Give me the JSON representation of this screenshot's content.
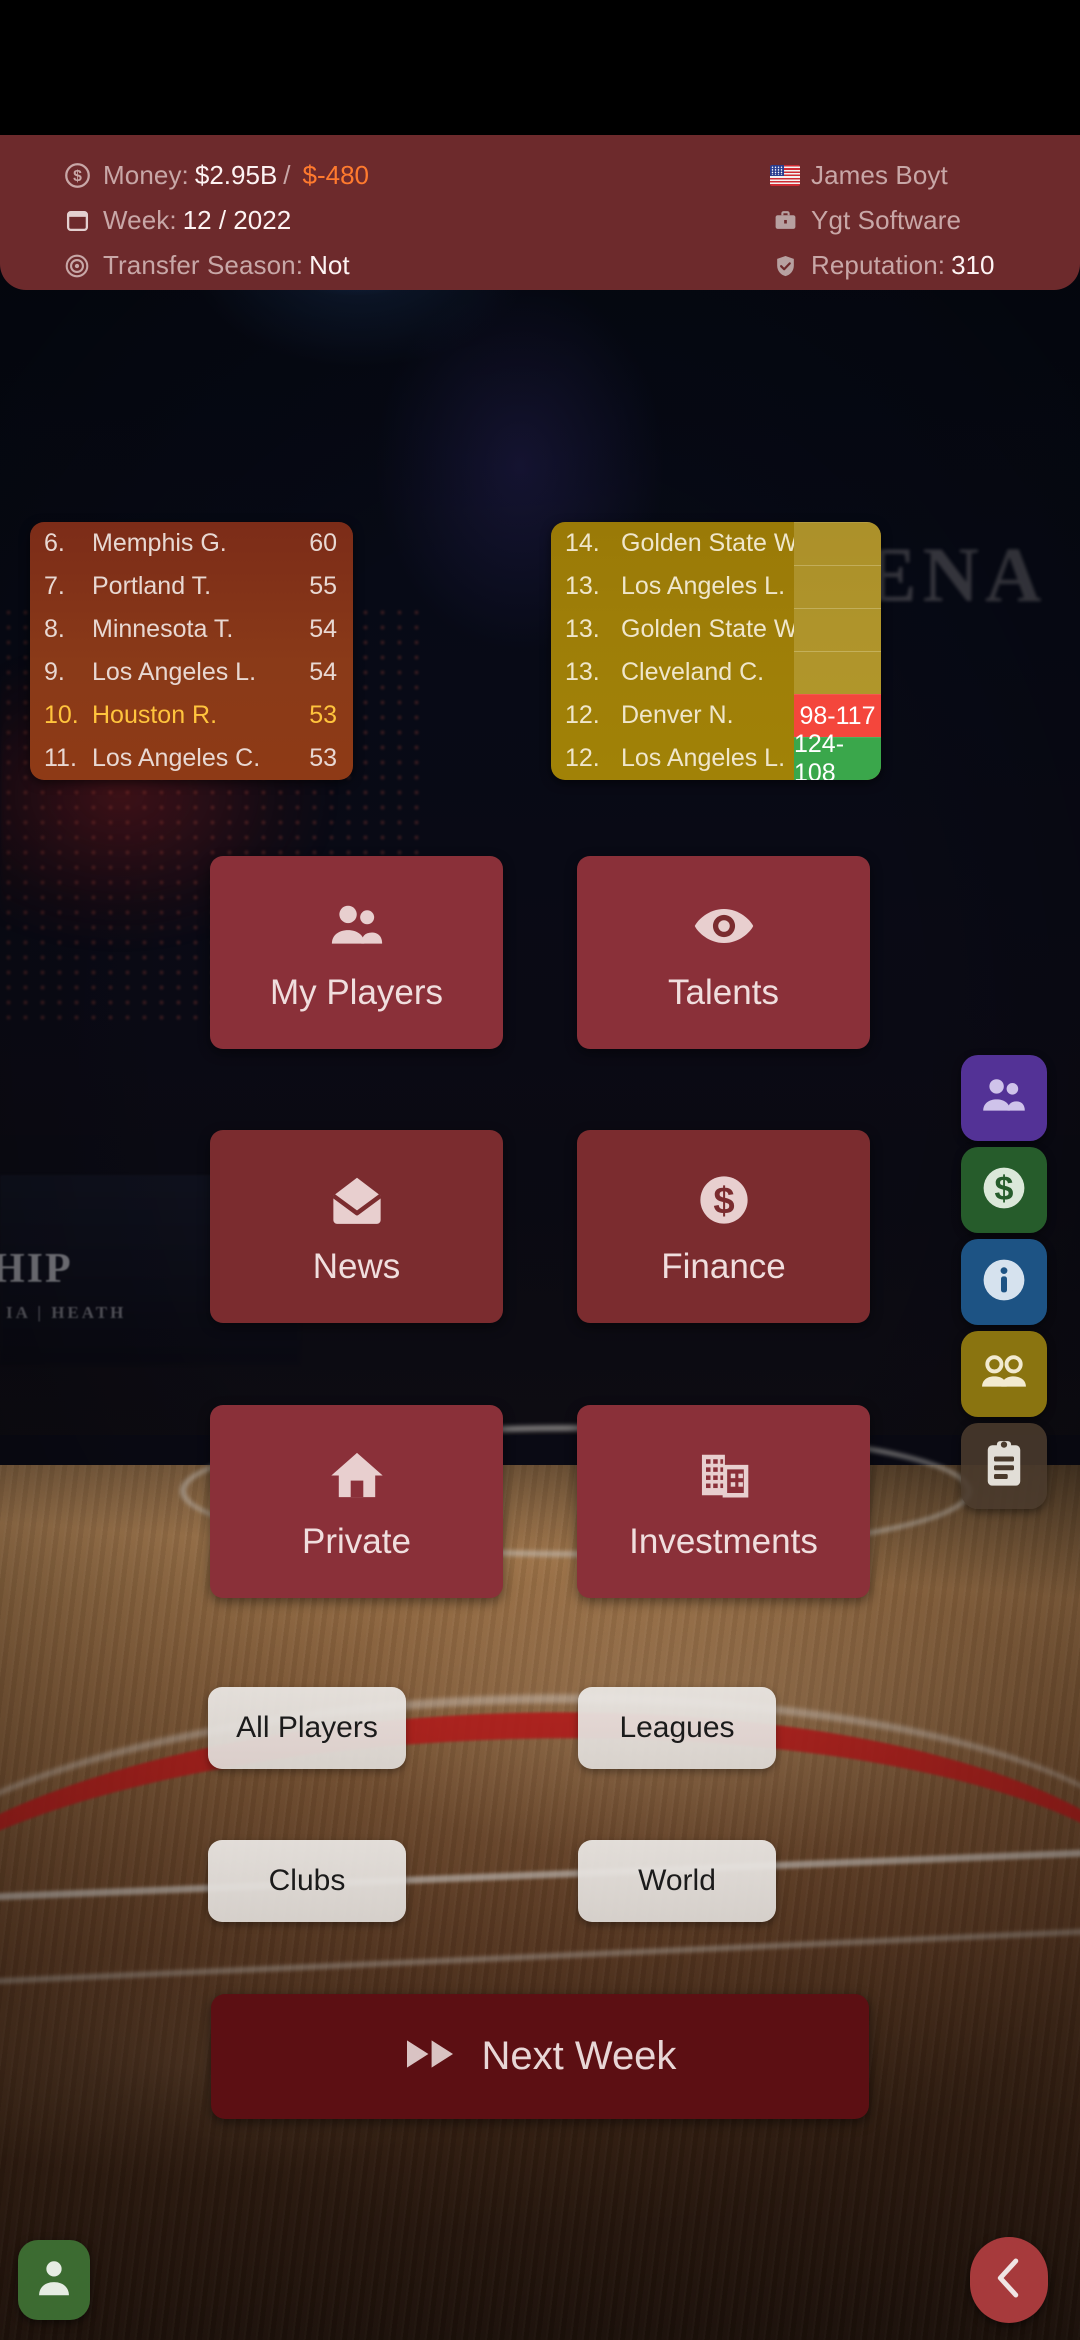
{
  "header": {
    "money": {
      "icon": "dollar-coin-icon",
      "label": "Money:",
      "value": "$2.95B",
      "separator": "/",
      "delta": "$-480"
    },
    "week": {
      "icon": "calendar-icon",
      "label": "Week:",
      "value": "12 / 2022"
    },
    "transfer": {
      "icon": "target-icon",
      "label": "Transfer Season:",
      "value": "Not"
    },
    "manager": {
      "icon": "us-flag-icon",
      "value": "James Boyt"
    },
    "company": {
      "icon": "briefcase-icon",
      "value": "Ygt Software"
    },
    "reputation": {
      "icon": "shield-check-icon",
      "label": "Reputation:",
      "value": "310"
    }
  },
  "standings": {
    "rows": [
      {
        "rank": "6.",
        "name": "Memphis G.",
        "value": "60",
        "highlight": false
      },
      {
        "rank": "7.",
        "name": "Portland T.",
        "value": "55",
        "highlight": false
      },
      {
        "rank": "8.",
        "name": "Minnesota T.",
        "value": "54",
        "highlight": false
      },
      {
        "rank": "9.",
        "name": "Los Angeles L.",
        "value": "54",
        "highlight": false
      },
      {
        "rank": "10.",
        "name": "Houston R.",
        "value": "53",
        "highlight": true
      },
      {
        "rank": "11.",
        "name": "Los Angeles C.",
        "value": "53",
        "highlight": false
      }
    ]
  },
  "fixtures": {
    "rows": [
      {
        "rank": "14.",
        "name": "Golden State W.",
        "score": "",
        "result": "none"
      },
      {
        "rank": "13.",
        "name": "Los Angeles L.",
        "score": "",
        "result": "none"
      },
      {
        "rank": "13.",
        "name": "Golden State W.",
        "score": "",
        "result": "none"
      },
      {
        "rank": "13.",
        "name": "Cleveland C.",
        "score": "",
        "result": "none"
      },
      {
        "rank": "12.",
        "name": "Denver N.",
        "score": "98-117",
        "result": "loss"
      },
      {
        "rank": "12.",
        "name": "Los Angeles L.",
        "score": "124-108",
        "result": "win"
      }
    ]
  },
  "tiles": [
    {
      "label": "My Players",
      "icon": "people-icon"
    },
    {
      "label": "Talents",
      "icon": "eye-icon"
    },
    {
      "label": "News",
      "icon": "mail-open-icon"
    },
    {
      "label": "Finance",
      "icon": "dollar-coin-icon"
    },
    {
      "label": "Private",
      "icon": "home-icon"
    },
    {
      "label": "Investments",
      "icon": "building-icon"
    }
  ],
  "rail": [
    {
      "name": "staff-shortcut",
      "icon": "people-icon",
      "color": "#533296"
    },
    {
      "name": "finance-shortcut",
      "icon": "dollar-coin-icon",
      "color": "#265c2b"
    },
    {
      "name": "info-shortcut",
      "icon": "info-icon",
      "color": "#1d5384"
    },
    {
      "name": "scouts-shortcut",
      "icon": "group-icon",
      "color": "#8a7410"
    },
    {
      "name": "reports-shortcut",
      "icon": "clipboard-icon",
      "color": "#4a3a2c"
    }
  ],
  "nav_buttons": [
    {
      "label": "All Players"
    },
    {
      "label": "Leagues"
    },
    {
      "label": "Clubs"
    },
    {
      "label": "World"
    }
  ],
  "next_week": {
    "label": "Next Week",
    "icon": "fast-forward-icon"
  },
  "fabs": {
    "profile": {
      "icon": "person-icon",
      "color": "#3c6b31"
    },
    "back": {
      "icon": "chevron-left-icon",
      "color": "#a73a3c"
    }
  },
  "background": {
    "arena_sign": "ARENA",
    "board_line1": "HIP",
    "board_line2": "IA | HEATH"
  },
  "colors": {
    "header_bg": "#6d2a2c",
    "tile_bg": "#8a3039",
    "standings_bg": "#803018",
    "fixtures_bg": "#9a7a07",
    "highlight": "#ffc43d",
    "win": "#3aa74b",
    "loss": "#f4463c",
    "next_week_bg": "#5c0f13"
  }
}
